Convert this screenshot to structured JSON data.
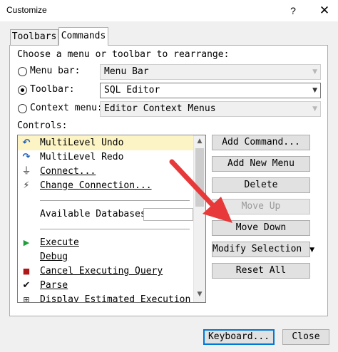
{
  "window": {
    "title": "Customize",
    "help_label": "?",
    "close_label": "✕"
  },
  "tabs": [
    {
      "label": "Toolbars",
      "active": false
    },
    {
      "label": "Commands",
      "active": true
    }
  ],
  "choose_label": "Choose a menu or toolbar to rearrange:",
  "options": {
    "menu_bar": {
      "label": "Menu bar:",
      "value": "Menu Bar",
      "checked": false
    },
    "toolbar": {
      "label": "Toolbar:",
      "value": "SQL Editor",
      "checked": true
    },
    "context_menu": {
      "label": "Context menu:",
      "value": "Editor Context Menus",
      "checked": false
    }
  },
  "controls_label": "Controls:",
  "controls": [
    {
      "icon": "undo-icon",
      "label": "MultiLevel Undo",
      "selected": true
    },
    {
      "icon": "redo-icon",
      "label": "MultiLevel Redo"
    },
    {
      "icon": "plug-icon",
      "label": "Connect..."
    },
    {
      "icon": "change-connection-icon",
      "label": "Change Connection..."
    },
    {
      "icon": "",
      "label": "Available Databases"
    },
    {
      "icon": "play-icon",
      "label": "Execute"
    },
    {
      "icon": "",
      "label": "Debug"
    },
    {
      "icon": "stop-icon",
      "label": "Cancel Executing Query"
    },
    {
      "icon": "check-icon",
      "label": "Parse"
    },
    {
      "icon": "execution-plan-icon",
      "label": "Display Estimated Execution Pl"
    }
  ],
  "buttons": {
    "add_command": "Add Command...",
    "add_new_menu": "Add New Menu",
    "delete": "Delete",
    "move_up": "Move Up",
    "move_down": "Move Down",
    "modify_selection": "Modify Selection",
    "reset_all": "Reset All",
    "keyboard": "Keyboard...",
    "close": "Close"
  },
  "annotation_color": "#e8393a"
}
